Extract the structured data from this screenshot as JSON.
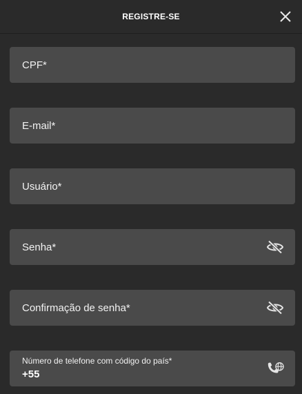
{
  "header": {
    "title": "REGISTRE-SE"
  },
  "fields": {
    "cpf": {
      "label": "CPF*"
    },
    "email": {
      "label": "E-mail*"
    },
    "usuario": {
      "label": "Usuário*"
    },
    "senha": {
      "label": "Senha*"
    },
    "confirmacao": {
      "label": "Confirmação de senha*"
    },
    "telefone": {
      "label": "Número de telefone com código do país*",
      "value": "+55"
    }
  },
  "icons": {
    "close": "close-icon",
    "password_toggle": "eye-off-icon",
    "phone_country": "phone-globe-icon"
  },
  "colors": {
    "background": "#2a2a2a",
    "field": "#4a4a4a",
    "text": "#ffffff"
  }
}
